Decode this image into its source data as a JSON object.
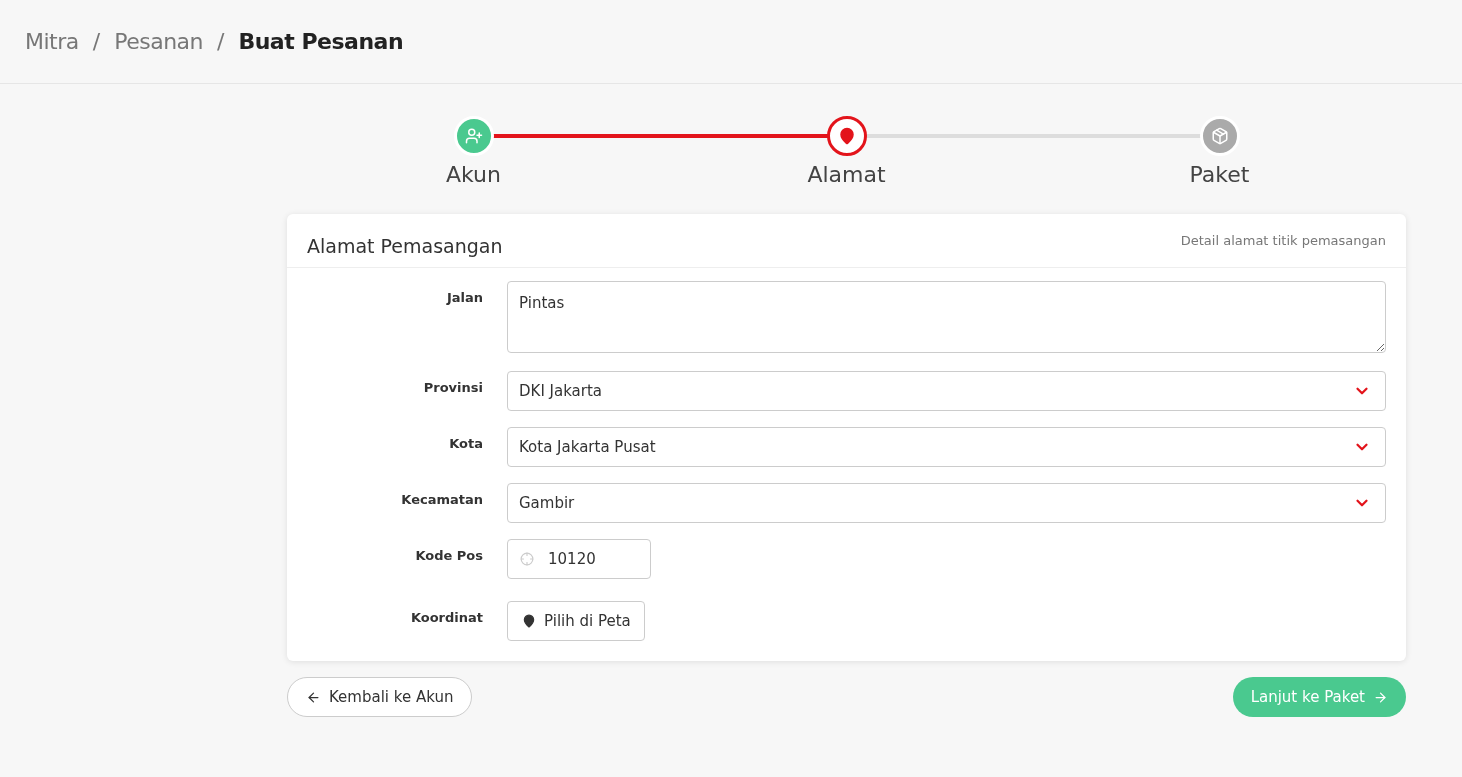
{
  "breadcrumb": [
    {
      "label": "Mitra",
      "current": false
    },
    {
      "separator": "/",
      "label": "Pesanan",
      "current": false
    },
    {
      "separator": "/",
      "label": "Buat Pesanan",
      "current": true
    }
  ],
  "steps": [
    {
      "label": "Akun",
      "completed": true,
      "selected": false
    },
    {
      "label": "Alamat",
      "completed": false,
      "selected": true
    },
    {
      "label": "Paket",
      "completed": false,
      "selected": false
    }
  ],
  "card": {
    "title": "Alamat Pemasangan",
    "subtitle": "Detail alamat titik pemasangan"
  },
  "fields": [
    {
      "kind": "textarea",
      "label": "Jalan",
      "value": "Pintas"
    },
    {
      "kind": "select",
      "label": "Provinsi",
      "value": "DKI Jakarta"
    },
    {
      "kind": "select",
      "label": "Kota",
      "value": "Kota Jakarta Pusat"
    },
    {
      "kind": "select",
      "label": "Kecamatan",
      "value": "Gambir"
    },
    {
      "kind": "postal",
      "label": "Kode Pos",
      "value": "10120"
    },
    {
      "kind": "map",
      "label": "Koordinat",
      "value": "Pilih di Peta"
    }
  ],
  "back_button": "Kembali ke Akun",
  "next_button": "Lanjut ke Paket"
}
